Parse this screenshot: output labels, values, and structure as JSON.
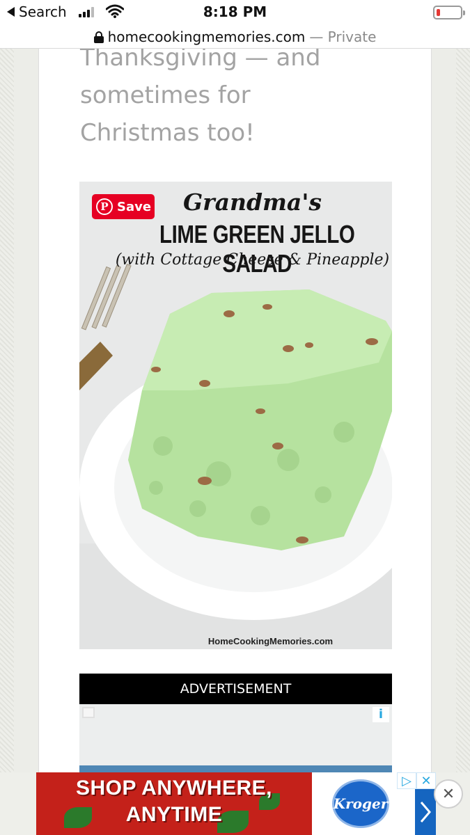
{
  "status_bar": {
    "back_label": "Search",
    "time": "8:18 PM",
    "signal_icon": "signal-bars-icon",
    "wifi_icon": "wifi-icon",
    "battery_icon": "battery-low-icon",
    "battery_color": "#e53935"
  },
  "url_bar": {
    "domain": "homecookingmemories.com",
    "mode": "— Private"
  },
  "article": {
    "paragraph": "Thanksgiving — and sometimes for Christmas too!"
  },
  "recipe_image": {
    "save_button": "Save",
    "pin_logo": "P",
    "title_line1": "Grandma's",
    "title_line2": "LIME GREEN JELLO SALAD",
    "title_line3": "(with Cottage Cheese & Pineapple)",
    "credit": "HomeCookingMemories.com",
    "jello_color": "#bde6a8",
    "save_color": "#e60023"
  },
  "advertisement": {
    "label": "ADVERTISEMENT",
    "adchoices_icon": "adchoices-icon",
    "adchoices_glyph": "i"
  },
  "banner_ad": {
    "line1": "SHOP ANYWHERE,",
    "line2": "ANYTIME",
    "brand": "Kroger",
    "play_glyph": "▷",
    "close_glyph": "✕",
    "next_glyph": "›",
    "dismiss_glyph": "✕",
    "brand_color": "#1b66c9"
  }
}
